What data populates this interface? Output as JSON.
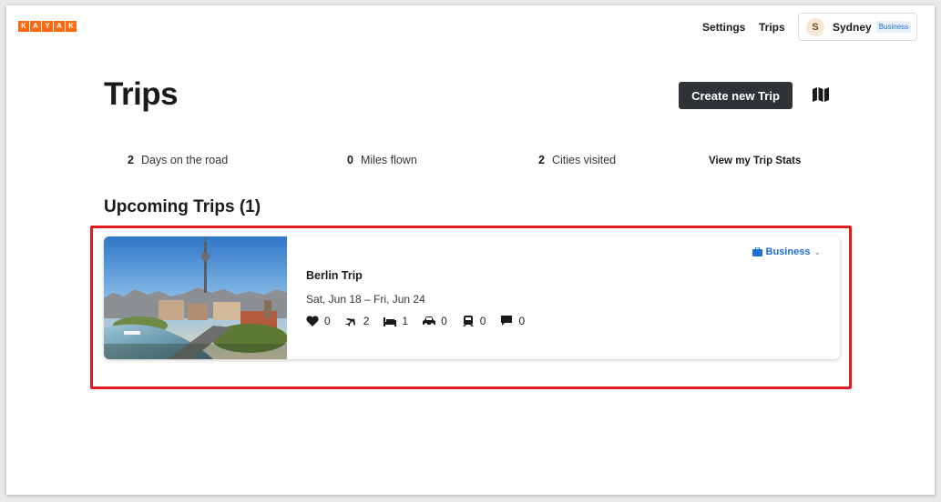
{
  "header": {
    "logo_letters": [
      "K",
      "A",
      "Y",
      "A",
      "K"
    ],
    "nav": {
      "settings": "Settings",
      "trips": "Trips"
    },
    "user": {
      "initial": "S",
      "name": "Sydney",
      "badge": "Business"
    }
  },
  "page": {
    "title": "Trips",
    "create_button": "Create new Trip",
    "map_icon": "map-icon"
  },
  "stats": [
    {
      "value": "2",
      "label": "Days on the road"
    },
    {
      "value": "0",
      "label": "Miles flown"
    },
    {
      "value": "2",
      "label": "Cities visited"
    }
  ],
  "stats_link": "View my Trip Stats",
  "section_title": "Upcoming Trips (1)",
  "trip": {
    "name": "Berlin Trip",
    "dates": "Sat, Jun 18 – Fri, Jun 24",
    "type": "Business",
    "counts": {
      "favorites": "0",
      "flights": "2",
      "hotels": "1",
      "cars": "0",
      "trains": "0",
      "notes": "0"
    }
  },
  "colors": {
    "brand": "#ff690f",
    "button_dark": "#2f3337",
    "highlight": "#e0191b",
    "link_blue": "#1f6ed4"
  }
}
